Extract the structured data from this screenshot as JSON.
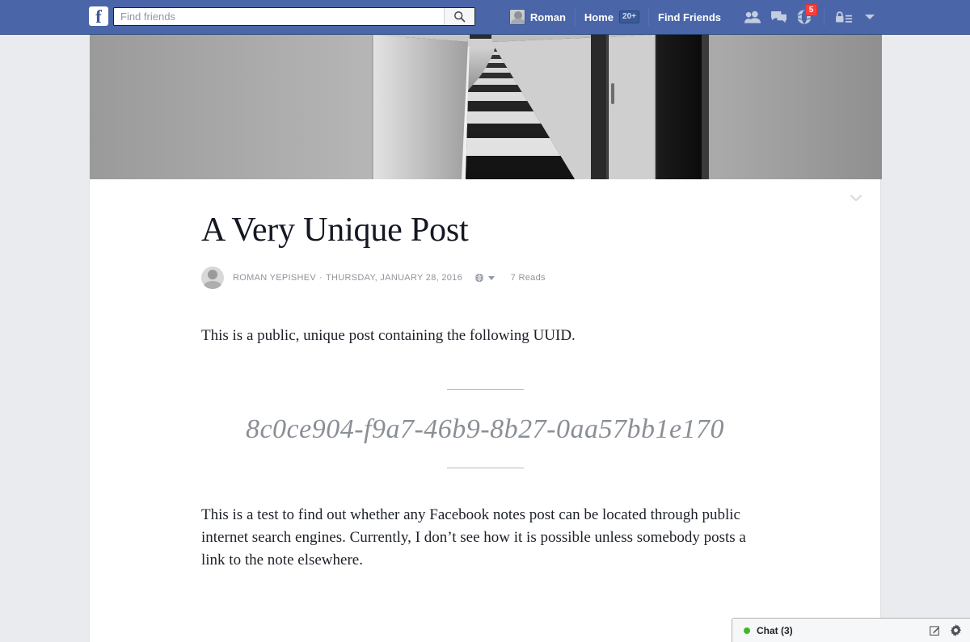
{
  "navbar": {
    "logo": "f",
    "logo_icon": "facebook-logo-icon",
    "search": {
      "placeholder": "Find friends",
      "value": "",
      "button_icon": "search-icon"
    },
    "profile_name": "Roman",
    "home_label": "Home",
    "home_badge": "20+",
    "find_friends_label": "Find Friends",
    "icons": [
      {
        "name": "friend-requests-icon",
        "badge": ""
      },
      {
        "name": "messages-icon",
        "badge": ""
      },
      {
        "name": "notifications-globe-icon",
        "badge": "5"
      }
    ],
    "privacy_icon": "privacy-lock-icon",
    "caret_icon": "account-caret-icon",
    "colors": {
      "nav_blue": "#4a66a8",
      "nav_border": "#29487d",
      "badge_red": "#fa3e3e"
    }
  },
  "cover": {
    "alt": "Black and white photograph of a long hallway with patterned carpet receding in perspective",
    "icon": "cover-photo"
  },
  "post": {
    "collapse_icon": "chevron-down-icon",
    "title": "A Very Unique Post",
    "author": "ROMAN YEPISHEV",
    "separator": "·",
    "date": "THURSDAY, JANUARY 28, 2016",
    "privacy_icon": "public-globe-icon",
    "privacy_caret_icon": "caret-down-icon",
    "reads": "7 Reads",
    "paragraph_1": "This is a public, unique post containing the following UUID.",
    "uuid": "8c0ce904-f9a7-46b9-8b27-0aa57bb1e170",
    "paragraph_2": "This is a test to find out whether any Facebook notes post can be located through public internet search engines. Currently, I don’t see how it is possible unless somebody posts a link to the note elsewhere."
  },
  "chat": {
    "status_icon": "online-status-dot",
    "label": "Chat (3)",
    "compose_icon": "compose-icon",
    "settings_icon": "gear-icon",
    "online_color": "#42b72a"
  }
}
